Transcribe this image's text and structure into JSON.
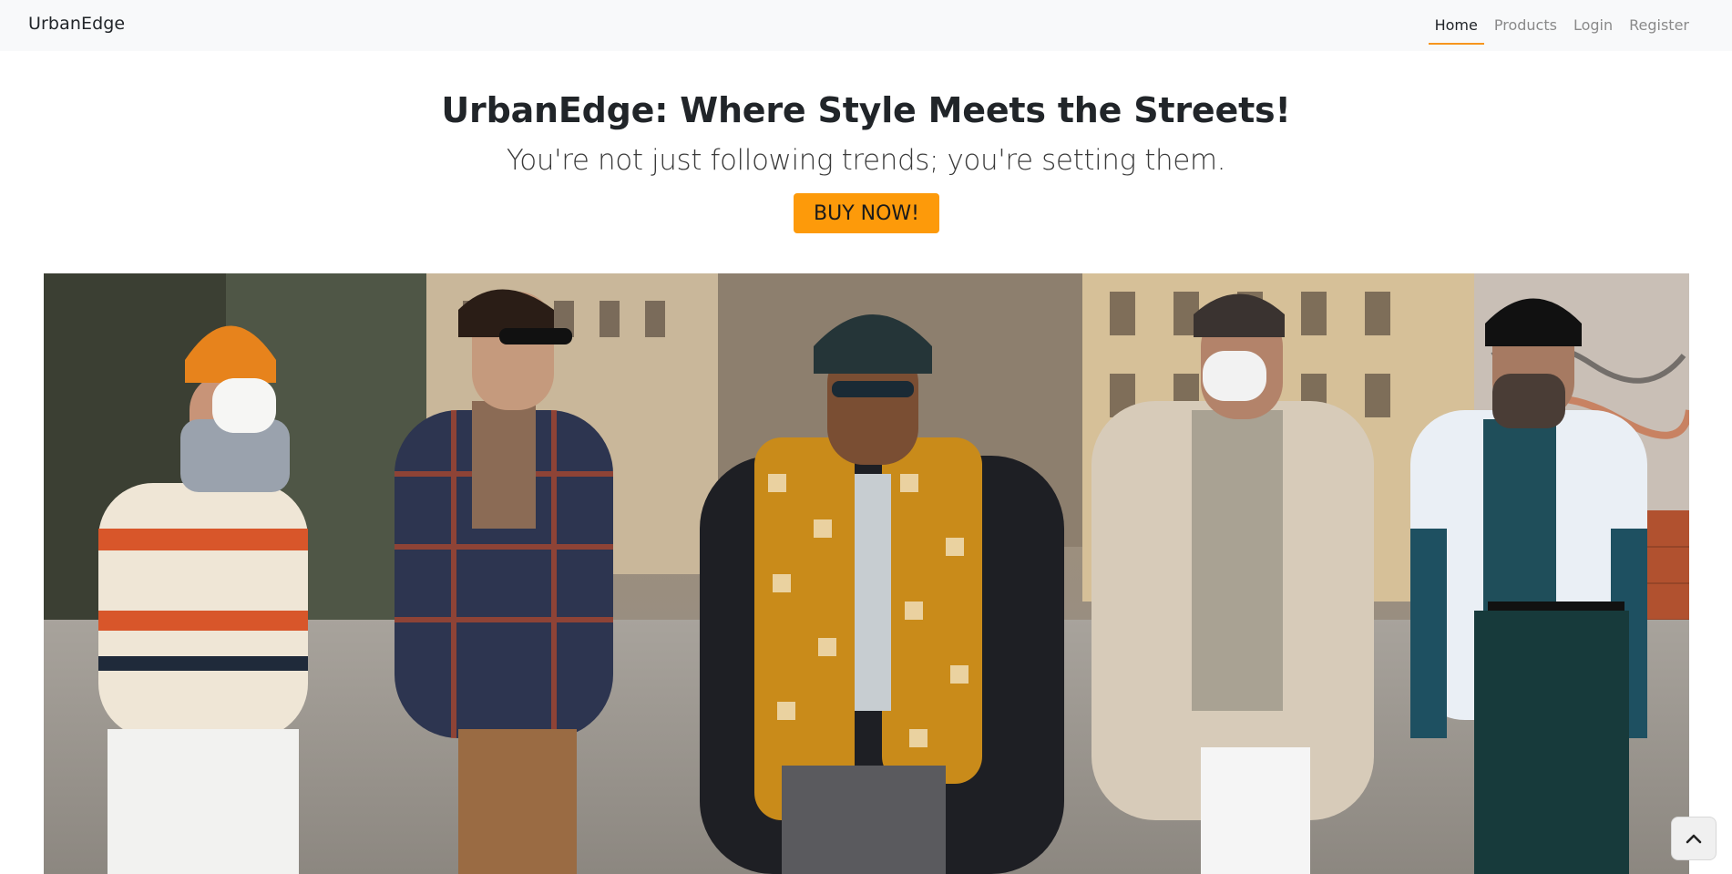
{
  "navbar": {
    "brand": "UrbanEdge",
    "links": [
      {
        "label": "Home",
        "active": true
      },
      {
        "label": "Products",
        "active": false
      },
      {
        "label": "Login",
        "active": false
      },
      {
        "label": "Register",
        "active": false
      }
    ]
  },
  "hero": {
    "title": "UrbanEdge: Where Style Meets the Streets!",
    "subtitle": "You're not just following trends; you're setting them.",
    "cta_label": "BUY NOW!"
  },
  "colors": {
    "accent": "#fd9a0a",
    "navbar_bg": "#f8f9fa",
    "active_underline": "#f7961e"
  },
  "icons": {
    "scroll_top": "chevron-up-icon"
  }
}
